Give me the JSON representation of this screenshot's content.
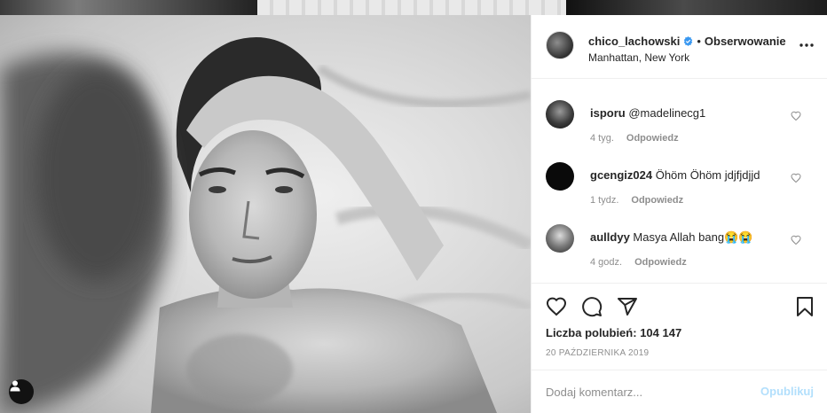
{
  "post": {
    "username": "chico_lachowski",
    "separator": "•",
    "follow_label": "Obserwowanie",
    "location": "Manhattan, New York",
    "verified_icon": "verified-badge-icon",
    "more_icon": "more-options-icon"
  },
  "comments": [
    {
      "user": "isporu",
      "text": "@madelinecg1",
      "time": "4 tyg.",
      "reply": "Odpowiedz",
      "avatar_color": "#3b3b3b"
    },
    {
      "user": "gcengiz024",
      "text": "Öhöm Öhöm jdjfjdjjd",
      "time": "1 tydz.",
      "reply": "Odpowiedz",
      "avatar_color": "#0a0a0a"
    },
    {
      "user": "aulldyy",
      "text": "Masya Allah bang😭😭",
      "time": "4 godz.",
      "reply": "Odpowiedz",
      "avatar_color": "#6a6a6a"
    }
  ],
  "likes": {
    "label": "Liczba polubień:",
    "count": "104 147"
  },
  "date": "20 PAŹDZIERNIKA 2019",
  "add_comment": {
    "placeholder": "Dodaj komentarz...",
    "publish": "Opublikuj"
  },
  "colors": {
    "accent_blue": "#b2dffc",
    "verified": "#3897f0",
    "muted": "#8e8e8e",
    "text": "#262626"
  }
}
